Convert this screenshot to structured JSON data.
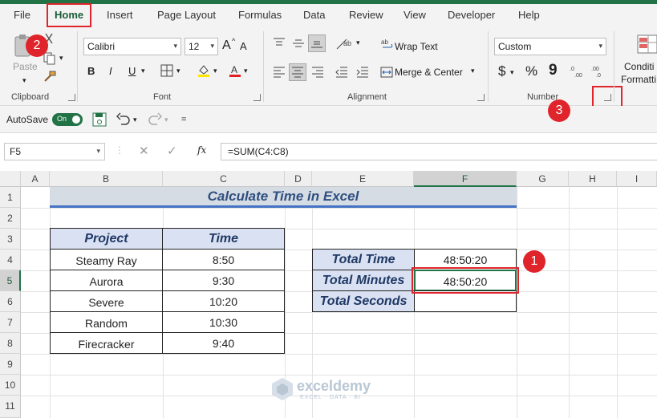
{
  "menu": {
    "tabs": [
      "File",
      "Home",
      "Insert",
      "Page Layout",
      "Formulas",
      "Data",
      "Review",
      "View",
      "Developer",
      "Help"
    ]
  },
  "ribbon": {
    "clipboard": {
      "paste": "Paste",
      "label": "Clipboard"
    },
    "font": {
      "name": "Calibri",
      "size": "12",
      "grow": "A",
      "shrink": "A",
      "bold": "B",
      "italic": "I",
      "underline": "U",
      "label": "Font"
    },
    "alignment": {
      "wrap": "Wrap Text",
      "merge": "Merge & Center",
      "label": "Alignment"
    },
    "number": {
      "format": "Custom",
      "currency": "$",
      "percent": "%",
      "comma": "9",
      "label": "Number"
    },
    "styles": {
      "conditional_line1": "Conditi",
      "conditional_line2": "Formatti"
    }
  },
  "qat": {
    "autosave": "AutoSave",
    "toggle": "On"
  },
  "formula_bar": {
    "namebox": "F5",
    "fx": "fx",
    "formula": "=SUM(C4:C8)"
  },
  "columns": [
    "A",
    "B",
    "C",
    "D",
    "E",
    "F",
    "G",
    "H",
    "I"
  ],
  "rows": [
    "1",
    "2",
    "3",
    "4",
    "5",
    "6",
    "7",
    "8",
    "9",
    "10",
    "11"
  ],
  "sheet": {
    "title": "Calculate Time in Excel",
    "table_headers": [
      "Project",
      "Time"
    ],
    "table_rows": [
      {
        "project": "Steamy Ray",
        "time": "8:50"
      },
      {
        "project": "Aurora",
        "time": "9:30"
      },
      {
        "project": "Severe",
        "time": "10:20"
      },
      {
        "project": "Random",
        "time": "10:30"
      },
      {
        "project": "Firecracker",
        "time": "9:40"
      }
    ],
    "summary": [
      {
        "label": "Total Time",
        "value": "48:50:20"
      },
      {
        "label": "Total Minutes",
        "value": "48:50:20"
      },
      {
        "label": "Total Seconds",
        "value": ""
      }
    ]
  },
  "callouts": [
    "1",
    "2",
    "3"
  ],
  "watermark": {
    "name": "exceldemy",
    "tagline": "EXCEL · DATA · BI"
  },
  "colors": {
    "accent": "#217346",
    "header_fill": "#d9e1f2",
    "header_text": "#1f3864",
    "callout": "#e0242b"
  }
}
